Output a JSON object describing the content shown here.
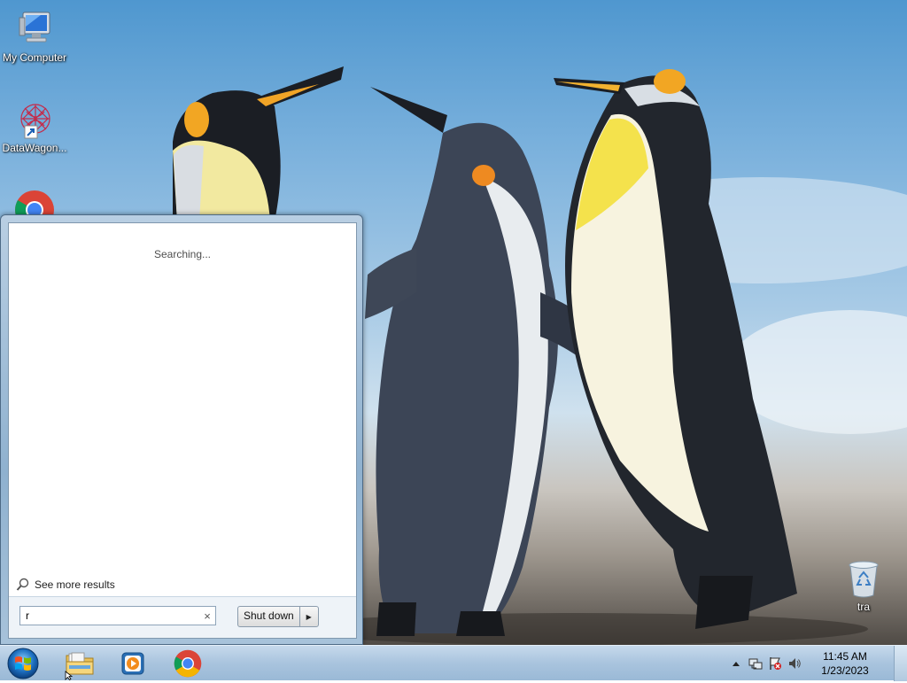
{
  "desktop": {
    "icons": [
      {
        "label": "My Computer",
        "icon": "computer-icon"
      },
      {
        "label": "DataWagon...",
        "icon": "datawagon-icon"
      },
      {
        "label": "",
        "icon": "chrome-icon"
      },
      {
        "label": "tra",
        "icon": "recycle-bin-icon"
      }
    ]
  },
  "start_menu": {
    "status_text": "Searching...",
    "see_more_label": "See more results",
    "search": {
      "value": "r"
    },
    "clear_glyph": "×",
    "shutdown_label": "Shut down"
  },
  "taskbar": {
    "pinned": [
      "file-explorer-icon",
      "media-player-icon",
      "chrome-icon"
    ],
    "clock": {
      "time": "11:45 AM",
      "date": "1/23/2023"
    }
  }
}
